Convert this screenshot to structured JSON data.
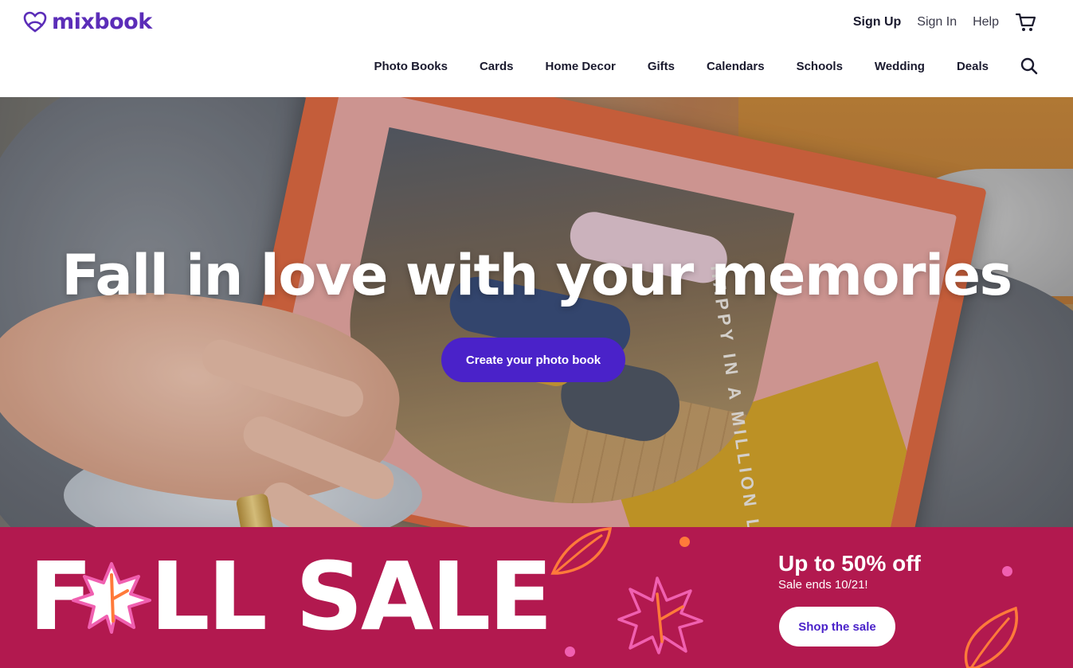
{
  "brand": {
    "name": "mixbook",
    "color": "#5b2db8"
  },
  "utility_nav": {
    "sign_up": "Sign Up",
    "sign_in": "Sign In",
    "help": "Help",
    "cart_icon": "cart-icon"
  },
  "main_nav": {
    "items": [
      "Photo Books",
      "Cards",
      "Home Decor",
      "Gifts",
      "Calendars",
      "Schools",
      "Wedding",
      "Deals"
    ],
    "search_icon": "search-icon"
  },
  "hero": {
    "title": "Fall in love with your memories",
    "cta": "Create your photo book",
    "book_caption": "HAPPY IN A MILLION LITTLE WAYS",
    "cta_color": "#4a22c9"
  },
  "sale": {
    "word_f": "F",
    "word_rest": "LL SALE",
    "headline": "Up to 50% off",
    "subline": "Sale ends 10/21!",
    "cta": "Shop the sale",
    "bg_color": "#b2194f",
    "accent_orange": "#ff7a3a",
    "accent_pink": "#f060b0"
  }
}
